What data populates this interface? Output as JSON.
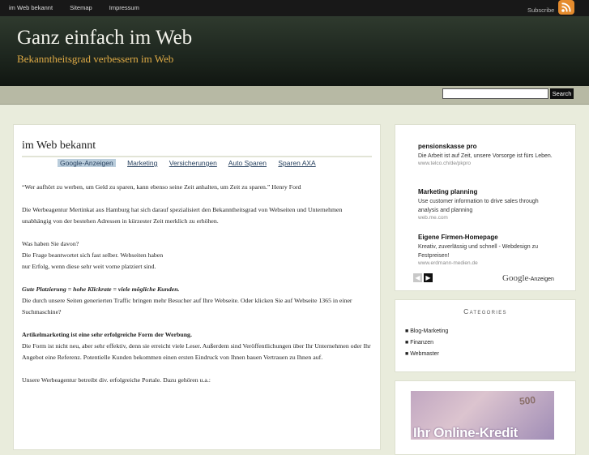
{
  "topnav": {
    "items": [
      "im Web bekannt",
      "Sitemap",
      "Impressum"
    ],
    "subscribe": "Subscribe"
  },
  "header": {
    "title": "Ganz einfach im Web",
    "description": "Bekanntheitsgrad verbessern im Web"
  },
  "search": {
    "button_label": "Search",
    "value": ""
  },
  "main": {
    "title": "im Web bekannt",
    "ad_links": [
      "Google-Anzeigen",
      "Marketing",
      "Versicherungen",
      "Auto Sparen",
      "Sparen AXA"
    ],
    "quote": "“Wer aufhört zu werben, um Geld zu sparen, kann ebenso seine Zeit anhalten, um Zeit zu sparen.” Henry Ford",
    "p1": "Die Werbeagentur Mertinkat aus Hamburg hat sich darauf spezialisiert den Bekanntheitsgrad von Webseiten und Unternehmen unabhängig von der bestehen Adressen in kürzester Zeit merklich zu erhöhen.",
    "q1": "Was haben Sie davon?",
    "q1_answer_start": "Die Frage beantwortet sich fast selber. Webseiten haben",
    "q1_answer_end": "nur Erfolg, wenn diese sehr weit vorne platziert sind.",
    "emph": "Gute Platzierung = hohe Klickrate = viele mögliche Kunden.",
    "p2": "Die durch unsere Seiten generierten Traffic bringen mehr Besucher auf Ihre Webseite. Oder klicken Sie auf Webseite 1365 in einer Suchmaschine?",
    "h2": "Artikelmarketing ist eine sehr erfolgreiche Form der Werbung.",
    "p3": "Die Form ist nicht neu, aber sehr effektiv, denn sie erreicht viele Leser. Außerdem sind Veröffentlichungen über Ihr Unternehmen oder Ihr Angebot eine Referenz. Potentielle Kunden bekommen einen ersten Eindruck von Ihnen bauen Vertrauen zu Ihnen auf.",
    "p4": "Unsere Werbeagentur betreibt div. erfolgreiche Portale. Dazu gehören u.a.:"
  },
  "sidebar": {
    "ads": [
      {
        "title": "pensionskasse pro",
        "desc": "Die Arbeit ist auf Zeit, unsere Vorsorge ist fürs Leben.",
        "url": "www.telco.ch/de/pkpro"
      },
      {
        "title": "Marketing planning",
        "desc": "Use customer information to drive sales through analysis and planning",
        "url": "web.me.com"
      },
      {
        "title": "Eigene Firmen-Homepage",
        "desc": "Kreativ, zuverlässig und schnell - Webdesign zu Festpreisen!",
        "url": "www.erdmann-medien.de"
      }
    ],
    "ads_label_brand": "Google",
    "ads_label_suffix": "-Anzeigen",
    "categories_title": "Categories",
    "categories": [
      "Blog-Marketing",
      "Finanzen",
      "Webmaster"
    ],
    "banner": {
      "text": "Ihr Online-Kredit",
      "note": "500"
    }
  },
  "colors": {
    "header_bg": "#1e271f",
    "subtitle": "#dfab46",
    "rss": "#e58b2d",
    "page_bg": "#e9ecdc"
  },
  "icons": {
    "rss": "rss-icon",
    "prev": "arrow-left-icon",
    "next": "arrow-right-icon"
  }
}
